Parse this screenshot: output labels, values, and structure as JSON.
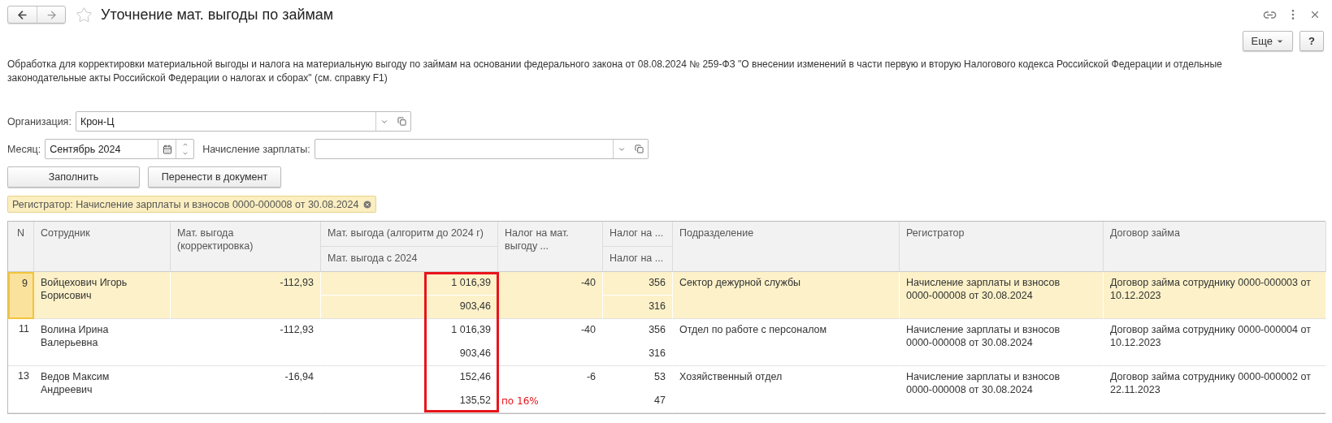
{
  "window": {
    "title": "Уточнение мат. выгоды по займам",
    "favorite": false
  },
  "toolbar": {
    "buttons": [
      {
        "label": "Еще",
        "kind": "menu"
      },
      {
        "label": "?",
        "kind": "plain"
      }
    ]
  },
  "description": "Обработка для корректировки материальной выгоды и налога на материальную выгоду по займам на основании федерального закона от 08.08.2024 № 259-ФЗ \"О внесении изменений в части первую и вторую Налогового кодекса Российской Федерации и отдельные законодательные акты Российской Федерации о налогах и сборах\" (см. справку F1)",
  "form": {
    "organization": {
      "label": "Организация:",
      "value": "Крон-Ц"
    },
    "month": {
      "label": "Месяц:",
      "value": "Сентябрь 2024"
    },
    "payroll": {
      "label": "Начисление зарплаты:"
    }
  },
  "actions": [
    "Заполнить",
    "Перенести в документ"
  ],
  "filter_tag": {
    "text": "Регистратор: Начисление зарплаты и взносов 0000-000008 от 30.08.2024"
  },
  "table": {
    "columns": [
      {
        "label": "N"
      },
      {
        "label": "Сотрудник"
      },
      {
        "label": "Мат. выгода (корректировка)"
      },
      {
        "label": "Мат. выгода (алгоритм до 2024 г)",
        "sub": "Мат. выгода с 2024",
        "highlighted": true
      },
      {
        "label": "Налог на мат. выгоду ..."
      },
      {
        "label": "Налог на ...",
        "sub": "Налог на ..."
      },
      {
        "label": "Подразделение"
      },
      {
        "label": "Регистратор"
      },
      {
        "label": "Договор займа"
      }
    ],
    "rows": [
      {
        "selected": true,
        "cells": [
          "9",
          "Войцехович Игорь Борисович",
          "-112,93",
          [
            "1 016,39",
            "903,46"
          ],
          "-40",
          [
            "356",
            "316"
          ],
          "Сектор дежурной службы",
          "Начисление зарплаты и взносов 0000-000008 от 30.08.2024",
          "Договор займа сотруднику 0000-000003 от 10.12.2023"
        ]
      },
      {
        "selected": false,
        "cells": [
          "11",
          "Волина Ирина Валерьевна",
          "-112,93",
          [
            "1 016,39",
            "903,46"
          ],
          "-40",
          [
            "356",
            "316"
          ],
          "Отдел по работе с персоналом",
          "Начисление зарплаты и взносов 0000-000008 от 30.08.2024",
          "Договор займа сотруднику 0000-000004 от 10.12.2023"
        ]
      },
      {
        "selected": false,
        "cells": [
          "13",
          "Ведов Максим Андреевич",
          "-16,94",
          [
            "152,46",
            "135,52"
          ],
          "-6",
          [
            "53",
            "47"
          ],
          "Хозяйственный отдел",
          "Начисление зарплаты и взносов 0000-000008 от 30.08.2024",
          "Договор займа сотруднику 0000-000002 от 22.11.2023"
        ]
      }
    ],
    "annotation": "по 16%"
  }
}
